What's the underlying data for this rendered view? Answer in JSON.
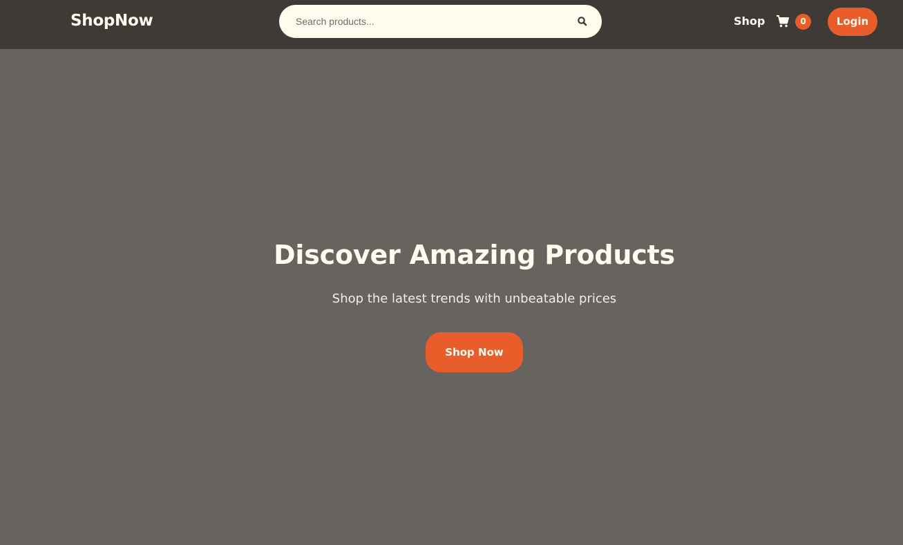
{
  "brand": {
    "name": "ShopNow"
  },
  "search": {
    "placeholder": "Search products...",
    "icon": "search-icon"
  },
  "nav": {
    "shop_label": "Shop",
    "cart": {
      "icon": "cart-icon",
      "count": "0"
    },
    "login_label": "Login"
  },
  "hero": {
    "title": "Discover Amazing Products",
    "subtitle": "Shop the latest trends with unbeatable prices",
    "cta_label": "Shop Now"
  },
  "colors": {
    "navbar_bg": "#3f3a36",
    "hero_bg": "#67635e",
    "accent": "#e85d2a",
    "text_light": "#fffbee"
  }
}
